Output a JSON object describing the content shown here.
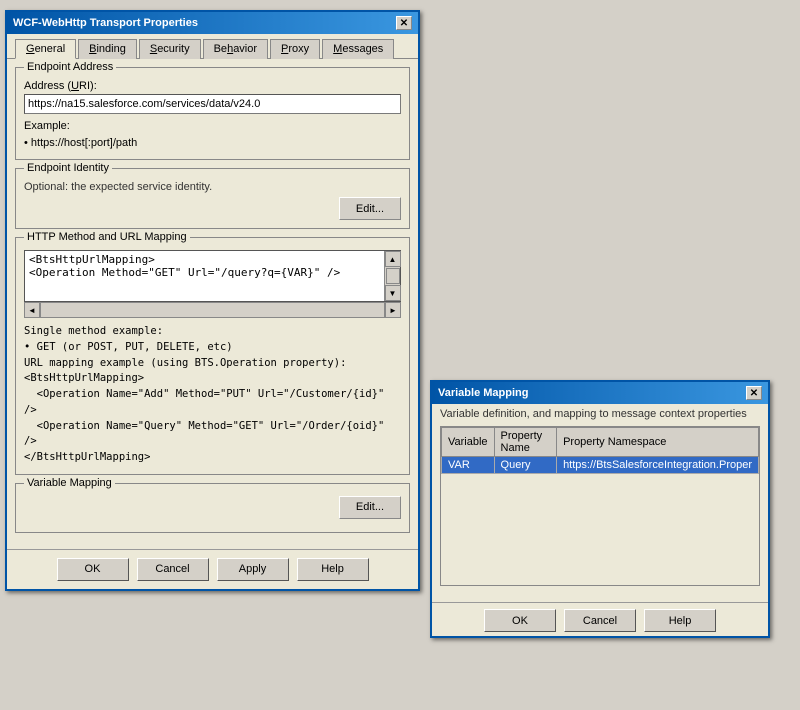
{
  "mainDialog": {
    "title": "WCF-WebHttp Transport Properties",
    "tabs": [
      {
        "label": "General",
        "underline": "G",
        "active": true
      },
      {
        "label": "Binding",
        "underline": "B"
      },
      {
        "label": "Security",
        "underline": "S"
      },
      {
        "label": "Behavior",
        "underline": "h"
      },
      {
        "label": "Proxy",
        "underline": "P"
      },
      {
        "label": "Messages",
        "underline": "M"
      }
    ],
    "endpointAddress": {
      "groupLabel": "Endpoint Address",
      "addressLabel": "Address (URI):",
      "addressValue": "https://na15.salesforce.com/services/data/v24.0",
      "exampleLabel": "Example:",
      "exampleValue": "• https://host[:port]/path"
    },
    "endpointIdentity": {
      "groupLabel": "Endpoint Identity",
      "description": "Optional: the expected service identity.",
      "editButton": "Edit..."
    },
    "httpMethod": {
      "groupLabel": "HTTP Method and URL Mapping",
      "mappingContent": "<BtsHttpUrlMapping>\n<Operation Method=\"GET\" Url=\"/query?q={VAR}\" />",
      "singleMethodExample": "Single method example:",
      "exampleLines": [
        "• GET (or POST, PUT, DELETE, etc)",
        "URL mapping example (using BTS.Operation property):",
        "<BtsHttpUrlMapping>",
        "  <Operation Name=\"Add\" Method=\"PUT\" Url=\"/Customer/{id}\" />",
        "  <Operation Name=\"Query\" Method=\"GET\" Url=\"/Order/{oid}\" />",
        "</BtsHttpUrlMapping>"
      ]
    },
    "variableMapping": {
      "groupLabel": "Variable Mapping",
      "editButton": "Edit..."
    },
    "buttons": {
      "ok": "OK",
      "cancel": "Cancel",
      "apply": "Apply",
      "help": "Help"
    }
  },
  "varDialog": {
    "title": "Variable Mapping",
    "subtitle": "Variable definition, and mapping to message context properties",
    "closeBtn": "✕",
    "tableHeaders": [
      "Variable",
      "Property Name",
      "Property Namespace"
    ],
    "tableRows": [
      {
        "variable": "VAR",
        "propertyName": "Query",
        "propertyNamespace": "https://BtsSalesforceIntegration.Proper"
      }
    ],
    "buttons": {
      "ok": "OK",
      "cancel": "Cancel",
      "help": "Help"
    }
  }
}
